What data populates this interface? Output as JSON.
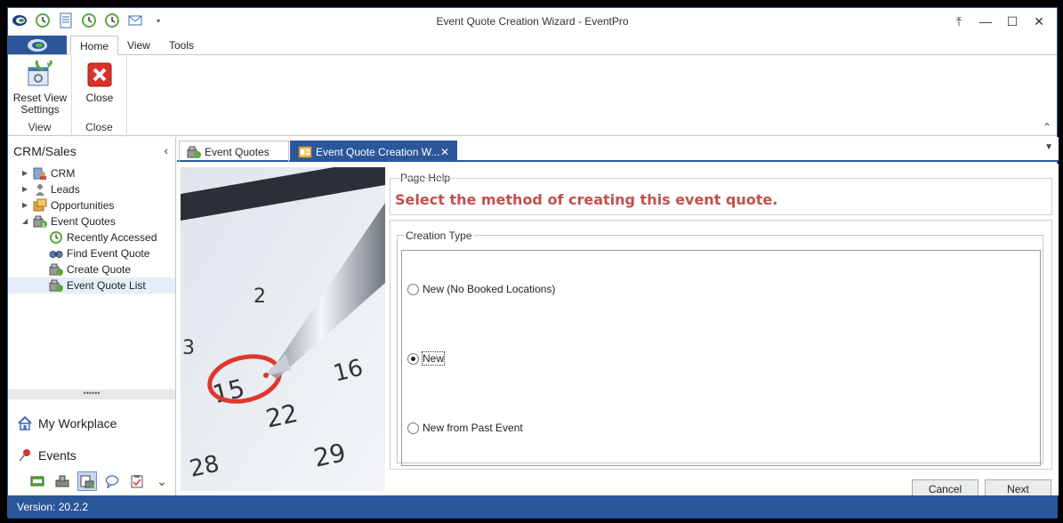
{
  "window": {
    "title": "Event Quote Creation Wizard - EventPro"
  },
  "quick_access": {
    "icons": [
      "app-logo-icon",
      "green-clock-icon",
      "document-icon",
      "green-clock-icon",
      "green-clock-icon",
      "mail-icon",
      "customize-dropdown-icon"
    ]
  },
  "window_controls": {
    "restore_up": "⤒",
    "minimize": "—",
    "maximize": "☐",
    "close": "✕"
  },
  "ribbon": {
    "tabs": [
      "Home",
      "View",
      "Tools"
    ],
    "groups": [
      {
        "label": "View",
        "button": "Reset View Settings"
      },
      {
        "label": "Close",
        "button": "Close"
      }
    ],
    "collapse_glyph": "⌃"
  },
  "sidebar": {
    "title": "CRM/Sales",
    "collapse_glyph": "‹",
    "tree": [
      {
        "label": "CRM",
        "expanded": false
      },
      {
        "label": "Leads",
        "expanded": false
      },
      {
        "label": "Opportunities",
        "expanded": false
      },
      {
        "label": "Event Quotes",
        "expanded": true
      }
    ],
    "children": [
      {
        "label": "Recently Accessed"
      },
      {
        "label": "Find Event Quote"
      },
      {
        "label": "Create Quote"
      },
      {
        "label": "Event Quote List"
      }
    ],
    "splitter_dots": "••••••",
    "nav": [
      {
        "label": "My Workplace"
      },
      {
        "label": "Events"
      }
    ],
    "more_glyph": "⌄"
  },
  "doc_tabs": {
    "tabs": [
      {
        "label": "Event Quotes"
      },
      {
        "label": "Event Quote Creation W..."
      }
    ],
    "close_glyph": "✕",
    "menu_glyph": "▼"
  },
  "wizard": {
    "page_help_label": "Page Help",
    "page_help_text": "Select the method of creating this event quote.",
    "creation_type_label": "Creation Type",
    "options": [
      {
        "label": "New (No Booked Locations)",
        "checked": false
      },
      {
        "label": "New",
        "checked": true
      },
      {
        "label": "New from Past Event",
        "checked": false
      }
    ],
    "cancel_label": "Cancel",
    "next_label": "Next",
    "calendar_numbers": [
      "2",
      "3",
      "15",
      "16",
      "22",
      "28",
      "29"
    ]
  },
  "status": {
    "version": "Version: 20.2.2"
  },
  "colors": {
    "accent": "#2b579a",
    "help_text": "#c0504d"
  }
}
